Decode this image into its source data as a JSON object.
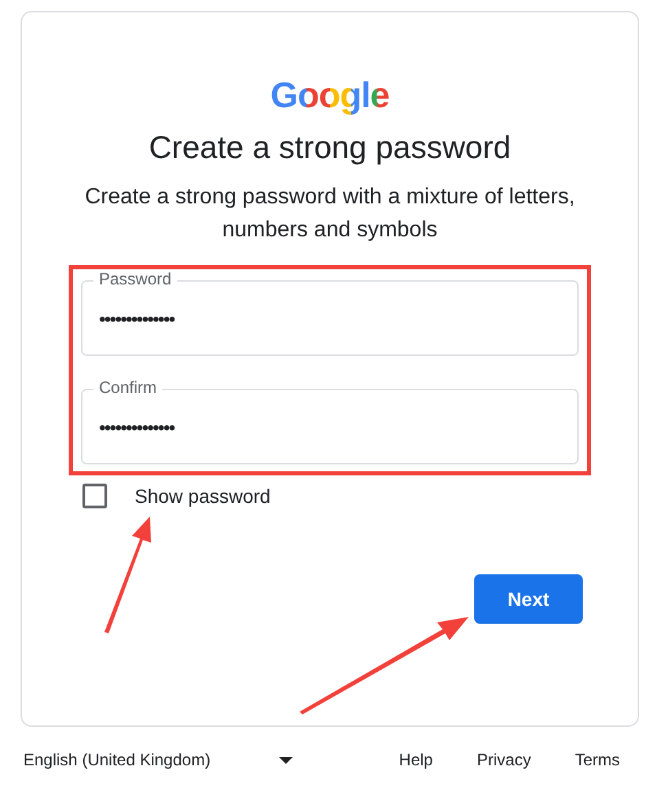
{
  "logo": "Google",
  "title": "Create a strong password",
  "subtitle": "Create a strong password with a mixture of letters, numbers and symbols",
  "fields": [
    {
      "label": "Password",
      "value": "••••••••••••••"
    },
    {
      "label": "Confirm",
      "value": "••••••••••••••"
    }
  ],
  "show_password": {
    "label": "Show password",
    "checked": false
  },
  "next_button": "Next",
  "footer": {
    "language": "English (United Kingdom)",
    "links": [
      "Help",
      "Privacy",
      "Terms"
    ]
  }
}
